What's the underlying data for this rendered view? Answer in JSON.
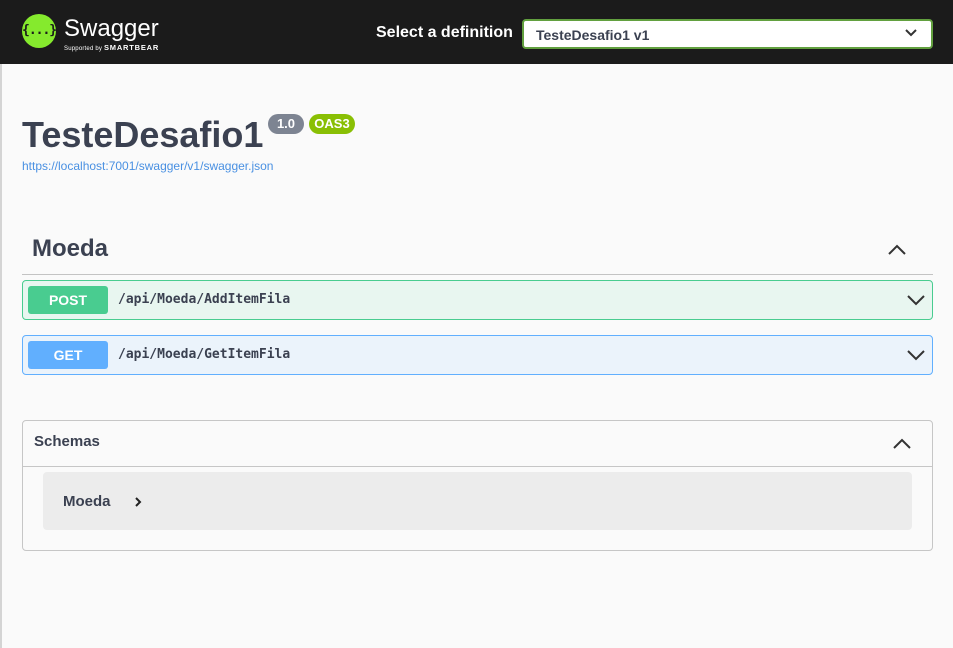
{
  "topbar": {
    "brand": "Swagger",
    "brand_tagline": "Supported by",
    "brand_company": "SMARTBEAR",
    "logo_glyph": "{...}",
    "definition_label": "Select a definition",
    "definition_selected": "TesteDesafio1 v1",
    "icons": {
      "logo": "swagger-logo-icon",
      "dropdown": "chevron-down-icon"
    }
  },
  "info": {
    "title": "TesteDesafio1",
    "version_badge": "1.0",
    "oas_badge": "OAS3",
    "spec_url": "https://localhost:7001/swagger/v1/swagger.json"
  },
  "tag": {
    "name": "Moeda",
    "expanded": true,
    "operations": [
      {
        "method": "POST",
        "path": "/api/Moeda/AddItemFila",
        "color": "#49cc90"
      },
      {
        "method": "GET",
        "path": "/api/Moeda/GetItemFila",
        "color": "#61affe"
      }
    ]
  },
  "schemas": {
    "title": "Schemas",
    "expanded": true,
    "models": [
      {
        "name": "Moeda"
      }
    ]
  },
  "colors": {
    "topbar": "#1b1b1b",
    "accent_green": "#85ea2d",
    "post": "#49cc90",
    "get": "#61affe",
    "text": "#3b4151",
    "link": "#4990e2"
  }
}
